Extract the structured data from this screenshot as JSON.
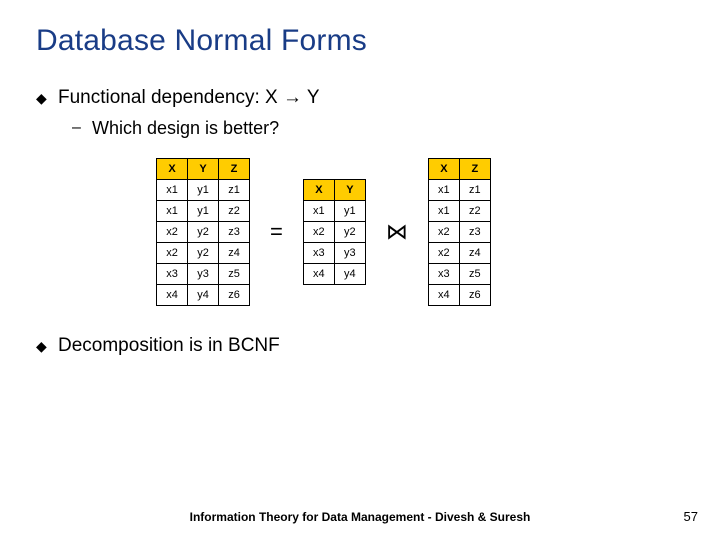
{
  "title": "Database Normal Forms",
  "bullet1": "Functional dependency: X → Y",
  "sub1": "Which design is better?",
  "bullet2": "Decomposition is in BCNF",
  "eq": "=",
  "join": "⋈",
  "footer": "Information Theory for Data Management - Divesh & Suresh",
  "page": "57",
  "table1": {
    "headers": [
      "X",
      "Y",
      "Z"
    ],
    "rows": [
      [
        "x1",
        "y1",
        "z1"
      ],
      [
        "x1",
        "y1",
        "z2"
      ],
      [
        "x2",
        "y2",
        "z3"
      ],
      [
        "x2",
        "y2",
        "z4"
      ],
      [
        "x3",
        "y3",
        "z5"
      ],
      [
        "x4",
        "y4",
        "z6"
      ]
    ]
  },
  "table2": {
    "headers": [
      "X",
      "Y"
    ],
    "rows": [
      [
        "x1",
        "y1"
      ],
      [
        "x2",
        "y2"
      ],
      [
        "x3",
        "y3"
      ],
      [
        "x4",
        "y4"
      ]
    ]
  },
  "table3": {
    "headers": [
      "X",
      "Z"
    ],
    "rows": [
      [
        "x1",
        "z1"
      ],
      [
        "x1",
        "z2"
      ],
      [
        "x2",
        "z3"
      ],
      [
        "x2",
        "z4"
      ],
      [
        "x3",
        "z5"
      ],
      [
        "x4",
        "z6"
      ]
    ]
  }
}
